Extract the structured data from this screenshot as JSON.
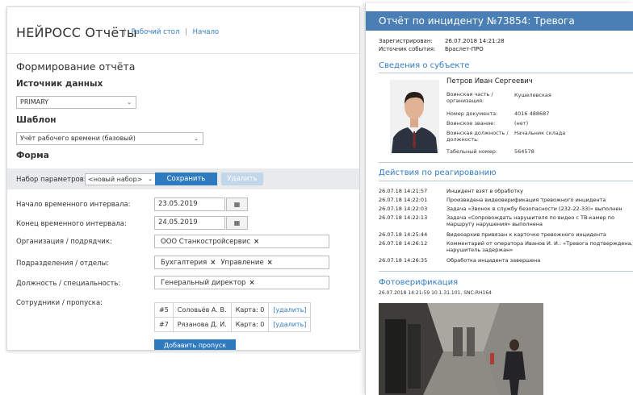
{
  "left": {
    "brand": "НЕЙРОСС Отчёты",
    "nav": {
      "separator": "|",
      "desktop": "Рабочий стол",
      "home": "Начало"
    },
    "page_title": "Формирование отчёта",
    "source": {
      "label": "Источник данных",
      "value": "PRIMARY"
    },
    "template": {
      "label": "Шаблон",
      "value": "Учёт рабочего времени (базовый)"
    },
    "form_label": "Форма",
    "params": {
      "label": "Набор параметров:",
      "select_value": "<новый набор>",
      "save": "Сохранить",
      "delete": "Удалить"
    },
    "fields": {
      "start": {
        "label": "Начало временного интервала:",
        "value": "23.05.2019"
      },
      "end": {
        "label": "Конец временного интервала:",
        "value": "24.05.2019"
      },
      "org": {
        "label": "Организация / подрядчик:",
        "tags": [
          "ООО Станкостройсервис"
        ]
      },
      "dept": {
        "label": "Подразделения / отделы:",
        "tags": [
          "Бухгалтерия",
          "Управление"
        ]
      },
      "position": {
        "label": "Должность / специальность:",
        "tags": [
          "Генеральный директор"
        ]
      },
      "employees": {
        "label": "Сотрудники / пропуска:",
        "rows": [
          {
            "num": "#5",
            "name": "Соловьёв А. В.",
            "card": "Карта: 0",
            "action": "[удалить]"
          },
          {
            "num": "#7",
            "name": "Рязанова Д. И.",
            "card": "Карта: 0",
            "action": "[удалить]"
          }
        ],
        "add_button": "Добавить пропуск"
      }
    },
    "remove_glyph": "×",
    "calendar_glyph": "▦",
    "chevron": "⌄"
  },
  "right": {
    "title": "Отчёт по инциденту №73854: Тревога",
    "meta": [
      {
        "k": "Зарегистрирован:",
        "v": "26.07.2018 14:21:28"
      },
      {
        "k": "Источник события:",
        "v": "Браслет-ПРО"
      }
    ],
    "subject": {
      "heading": "Сведения о субъекте",
      "name": "Петров Иван Сергеевич",
      "props": [
        {
          "k": "Воинская часть / организация:",
          "v": "Кушелевская"
        },
        {
          "k": "Номер документа:",
          "v": "4016 488687"
        },
        {
          "k": "Воинское звание:",
          "v": "(нет)"
        },
        {
          "k": "Воинская должность / должность:",
          "v": "Начальник склада"
        },
        {
          "k": "Табельный номер:",
          "v": "564578"
        }
      ]
    },
    "actions": {
      "heading": "Действия по реагированию",
      "rows": [
        {
          "t": "26.07.18 14:21:57",
          "d": "Инцидент взят в обработку"
        },
        {
          "t": "26.07.18 14:22:01",
          "d": "Произведена видеоверификация тревожного инцидента"
        },
        {
          "t": "26.07.18 14:22:03",
          "d": "Задача «Звонок в службу безопасности (232-22-33)» выполнен"
        },
        {
          "t": "26.07.18 14:22:13",
          "d": "Задача «Сопровождать нарушителя по видео с ТВ-камер по маршруту нарушения» выполнена"
        },
        {
          "t": "26.07.18 14:25:44",
          "d": "Видеоархив привязан к карточке тревожного инцидента"
        },
        {
          "t": "26.07.18 14:26:12",
          "d": "Комментарий от оператора Иванов И. И.: «Тревога подтверждена, нарушитель задержан»"
        },
        {
          "t": "26.07.18 14:26:35",
          "d": "Обработка инцидента завершена"
        }
      ]
    },
    "photo": {
      "heading": "Фотоверификация",
      "meta": "26.07.2018 14:21:59  10.1.31.101, SNC-RH164"
    }
  },
  "colors": {
    "accent": "#2f7bbf",
    "title_bar": "#4a7fb5",
    "params_bar": "#e9eaec"
  }
}
